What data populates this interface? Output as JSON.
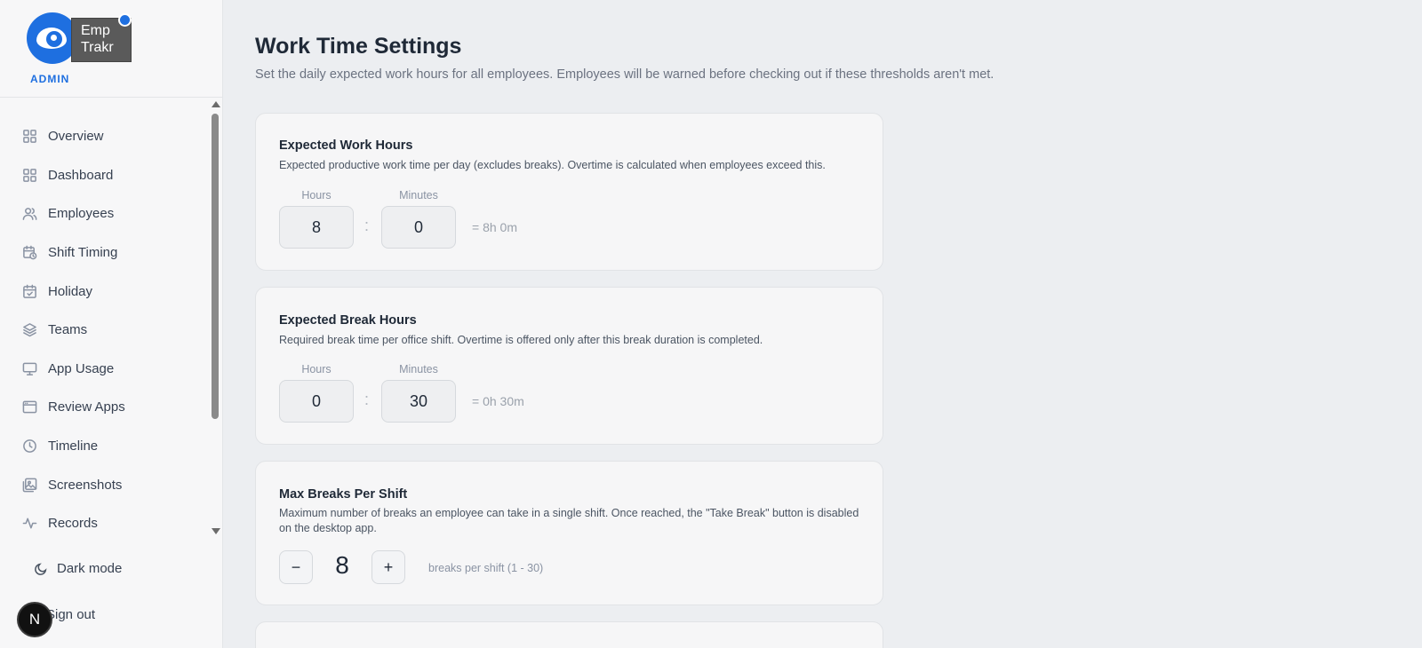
{
  "brand": {
    "line1": "Emp",
    "line2": "Trakr",
    "role": "ADMIN"
  },
  "nav": [
    {
      "label": "Overview",
      "icon": "grid-icon"
    },
    {
      "label": "Dashboard",
      "icon": "grid-icon"
    },
    {
      "label": "Employees",
      "icon": "users-icon"
    },
    {
      "label": "Shift Timing",
      "icon": "calendar-clock-icon"
    },
    {
      "label": "Holiday",
      "icon": "calendar-check-icon"
    },
    {
      "label": "Teams",
      "icon": "layers-icon"
    },
    {
      "label": "App Usage",
      "icon": "monitor-icon"
    },
    {
      "label": "Review Apps",
      "icon": "browser-icon"
    },
    {
      "label": "Timeline",
      "icon": "clock-icon"
    },
    {
      "label": "Screenshots",
      "icon": "image-icon"
    },
    {
      "label": "Records",
      "icon": "activity-icon"
    }
  ],
  "footer": {
    "dark_mode": "Dark mode",
    "sign_out": "Sign out",
    "badge": "N"
  },
  "page": {
    "title": "Work Time Settings",
    "subtitle": "Set the daily expected work hours for all employees. Employees will be warned before checking out if these thresholds aren't met."
  },
  "work": {
    "title": "Expected Work Hours",
    "desc": "Expected productive work time per day (excludes breaks). Overtime is calculated when employees exceed this.",
    "hours_label": "Hours",
    "minutes_label": "Minutes",
    "hours": "8",
    "minutes": "0",
    "colon": ":",
    "equals": "= 8h 0m"
  },
  "break": {
    "title": "Expected Break Hours",
    "desc": "Required break time per office shift. Overtime is offered only after this break duration is completed.",
    "hours_label": "Hours",
    "minutes_label": "Minutes",
    "hours": "0",
    "minutes": "30",
    "colon": ":",
    "equals": "= 0h 30m"
  },
  "max_breaks": {
    "title": "Max Breaks Per Shift",
    "desc": "Maximum number of breaks an employee can take in a single shift. Once reached, the \"Take Break\" button is disabled on the desktop app.",
    "minus": "−",
    "value": "8",
    "plus": "+",
    "hint": "breaks per shift (1 - 30)"
  },
  "colors": {
    "accent": "#1e6fe0",
    "background": "#eceef1",
    "card": "#f6f6f7"
  }
}
